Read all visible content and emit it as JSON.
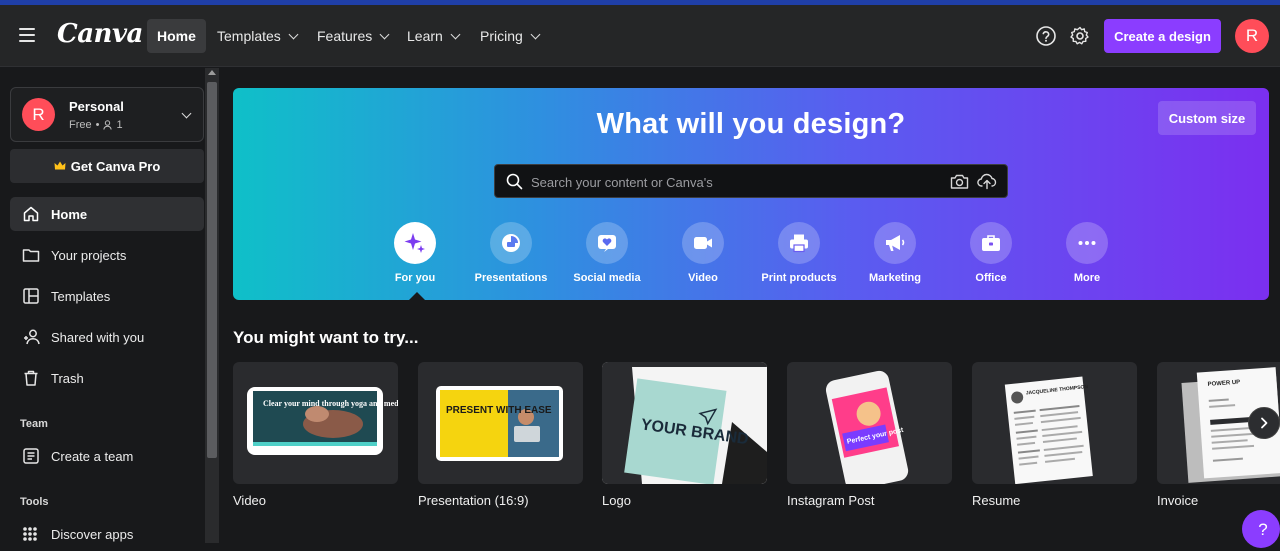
{
  "app": {
    "logo": "Canva"
  },
  "nav": {
    "items": [
      {
        "label": "Home",
        "active": true
      },
      {
        "label": "Templates",
        "dropdown": true
      },
      {
        "label": "Features",
        "dropdown": true
      },
      {
        "label": "Learn",
        "dropdown": true
      },
      {
        "label": "Pricing",
        "dropdown": true
      }
    ],
    "create_label": "Create a design",
    "avatar_initial": "R"
  },
  "sidebar": {
    "account": {
      "initial": "R",
      "name": "Personal",
      "plan": "Free",
      "members": "1"
    },
    "pro_label": "Get Canva Pro",
    "items": [
      {
        "label": "Home",
        "icon": "home-icon",
        "active": true
      },
      {
        "label": "Your projects",
        "icon": "folder-icon"
      },
      {
        "label": "Templates",
        "icon": "templates-icon"
      },
      {
        "label": "Shared with you",
        "icon": "people-icon"
      },
      {
        "label": "Trash",
        "icon": "trash-icon"
      }
    ],
    "team_section": "Team",
    "create_team": "Create a team",
    "tools_section": "Tools",
    "discover_apps": "Discover apps"
  },
  "hero": {
    "title": "What will you design?",
    "custom_size": "Custom size",
    "search_placeholder": "Search your content or Canva's",
    "categories": [
      {
        "label": "For you",
        "icon": "sparkle-icon",
        "selected": true
      },
      {
        "label": "Presentations",
        "icon": "presentation-icon"
      },
      {
        "label": "Social media",
        "icon": "heart-icon"
      },
      {
        "label": "Video",
        "icon": "video-icon"
      },
      {
        "label": "Print products",
        "icon": "printer-icon"
      },
      {
        "label": "Marketing",
        "icon": "megaphone-icon"
      },
      {
        "label": "Office",
        "icon": "briefcase-icon"
      },
      {
        "label": "More",
        "icon": "more-icon"
      }
    ]
  },
  "suggestions": {
    "title": "You might want to try...",
    "cards": [
      {
        "label": "Video",
        "thumb_text": "Clear your mind through yoga and meditation."
      },
      {
        "label": "Presentation (16:9)",
        "thumb_text": "PRESENT WITH EASE"
      },
      {
        "label": "Logo",
        "thumb_text": "YOUR BRAND"
      },
      {
        "label": "Instagram Post",
        "thumb_text": "Perfect your post"
      },
      {
        "label": "Resume",
        "thumb_text": "JACQUELINE THOMPSON"
      },
      {
        "label": "Invoice",
        "thumb_text": "POWER UP"
      }
    ]
  },
  "help_fab": "?"
}
